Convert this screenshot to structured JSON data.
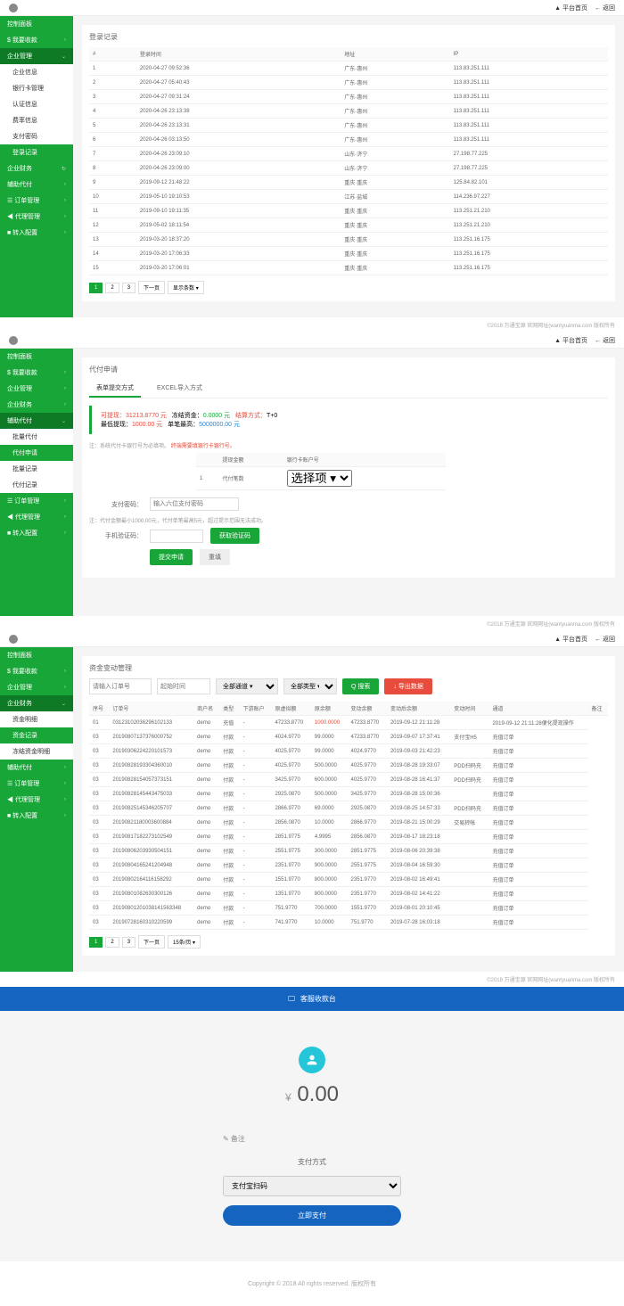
{
  "topbar": {
    "platform": "▲ 平台首页",
    "back": "← 返回"
  },
  "sidebar1": {
    "items": [
      "控制面板",
      "$ 我要收款",
      "企业管理"
    ],
    "sub1": [
      "企业信息",
      "银行卡管理",
      "认证信息",
      "费率信息",
      "支付密码",
      "登录记录"
    ],
    "items2": [
      "企业财务",
      "辅助代付",
      "☰ 订单管理",
      "◀ 代理管理",
      "■ 转入配置"
    ]
  },
  "panel1": {
    "title": "登录记录",
    "headers": [
      "#",
      "登录时间",
      "地址",
      "IP"
    ],
    "rows": [
      [
        "1",
        "2020-04-27 09:52:36",
        "广东·惠州",
        "113.83.251.111"
      ],
      [
        "2",
        "2020-04-27 05:40:43",
        "广东·惠州",
        "113.83.251.111"
      ],
      [
        "3",
        "2020-04-27 09:31:24",
        "广东·惠州",
        "113.83.251.111"
      ],
      [
        "4",
        "2020-04-26 23:13:38",
        "广东·惠州",
        "113.83.251.111"
      ],
      [
        "5",
        "2020-04-26 23:13:31",
        "广东·惠州",
        "113.83.251.111"
      ],
      [
        "6",
        "2020-04-26 03:13:50",
        "广东·惠州",
        "113.83.251.111"
      ],
      [
        "7",
        "2020-04-26 23:09:10",
        "山东·济宁",
        "27.198.77.225"
      ],
      [
        "8",
        "2020-04-26 23:09:00",
        "山东·济宁",
        "27.198.77.225"
      ],
      [
        "9",
        "2019-09-12 21:48:22",
        "重庆·重庆",
        "125.84.82.101"
      ],
      [
        "10",
        "2019-05-10 19:10:53",
        "江苏·盐城",
        "114.236.97.227"
      ],
      [
        "11",
        "2019-09-10 19:11:35",
        "重庆·重庆",
        "113.251.21.210"
      ],
      [
        "12",
        "2019-05-02 18:11:54",
        "重庆·重庆",
        "113.251.21.210"
      ],
      [
        "13",
        "2019-03-20 18:37:20",
        "重庆·重庆",
        "113.251.16.175"
      ],
      [
        "14",
        "2019-03-20 17:06:33",
        "重庆·重庆",
        "113.251.16.175"
      ],
      [
        "15",
        "2019-03-20 17:06:01",
        "重庆·重庆",
        "113.251.16.175"
      ]
    ],
    "pages": [
      "1",
      "2",
      "3",
      "下一页"
    ],
    "pageSize": "显示条数 ▾"
  },
  "footer": "©2018 万通宝源 官网网址(wantyuanma.com 版权所有",
  "sidebar2": {
    "items": [
      "控制面板",
      "$ 我要收款",
      "企业管理",
      "企业财务",
      "辅助代付"
    ],
    "sub": [
      "批量代付",
      "代付申请",
      "批量记录",
      "代付记录"
    ],
    "items2": [
      "☰ 订单管理",
      "◀ 代理管理",
      "■ 转入配置"
    ]
  },
  "panel2": {
    "title": "代付申请",
    "tabs": [
      "表单提交方式",
      "EXCEL导入方式"
    ],
    "info": {
      "l1a": "可提现：",
      "l1b": "31213.8770 元",
      "l1c": "冻结资金：",
      "l1d": "0.0000 元",
      "l1e": "结算方式：",
      "l1f": "T+0",
      "l2a": "最低提现：",
      "l2b": "1000.00 元",
      "l2c": "单笔最高：",
      "l2d": "5000000.00 元"
    },
    "note1": "注：系统代付卡银行号为必填项。",
    "note1b": "终端需要填银行卡银行号。",
    "th": [
      "",
      "提现金额",
      "银行卡账户号"
    ],
    "row1": [
      "1",
      "代付笔数",
      "选择项 ▾"
    ],
    "payPwdLabel": "支付密码：",
    "payPwdPh": "输入六位支付密码",
    "note2": "注：代付金额最小1000.00元，代付单笔最高5元，超过提示范围无法成功。",
    "codeLabel": "手机验证码：",
    "codeBtn": "获取验证码",
    "submit": "提交申请",
    "cancel": "重填"
  },
  "sidebar3": {
    "items": [
      "控制面板",
      "$ 我要收款",
      "企业管理",
      "企业财务"
    ],
    "sub": [
      "资金明细",
      "资金记录",
      "冻结资金明细"
    ],
    "items2": [
      "辅助代付",
      "☰ 订单管理",
      "◀ 代理管理",
      "■ 转入配置"
    ]
  },
  "panel3": {
    "title": "资金变动管理",
    "filters": {
      "orderPh": "请输入订单号",
      "startPh": "起始时间",
      "ch1": "全部通道 ▾",
      "ch2": "全部类型 ▾",
      "search": "Q 搜索",
      "export": "↓ 导出数据"
    },
    "headers": [
      "序号",
      "订单号",
      "商户名",
      "类型",
      "下游账户",
      "原虚拟额",
      "原余额",
      "变动余额",
      "变动后余额",
      "变动时间",
      "通道",
      "备注"
    ],
    "rows": [
      [
        "01",
        "03123102036296102133",
        "demo",
        "充值",
        "-",
        "47233.8770",
        "1000.0000",
        "47233.8770",
        "2019-09-12 21:11:28",
        "",
        "2019-09-12 21:11:28便化提现操作"
      ],
      [
        "03",
        "20190807137376000752",
        "demo",
        "付款",
        "-",
        "4024.9770",
        "99.0000",
        "47233.8770",
        "2019-09-07 17:37:41",
        "支付宝H5",
        "充值订单"
      ],
      [
        "03",
        "20190306224220101573",
        "demo",
        "付款",
        "-",
        "4025.9770",
        "99.0000",
        "4024.9770",
        "2019-09-03 21:42:23",
        "",
        "充值订单"
      ],
      [
        "03",
        "20190828193304360010",
        "demo",
        "付款",
        "-",
        "4025.9770",
        "500.0000",
        "4025.9770",
        "2019-08-28 19:33:07",
        "PDD扫码充",
        "充值订单"
      ],
      [
        "03",
        "20190828154057373151",
        "demo",
        "付款",
        "-",
        "3425.9770",
        "600.0000",
        "4025.9770",
        "2019-08-28 16:41:37",
        "PDD扫码充",
        "充值订单"
      ],
      [
        "03",
        "20190828145443475033",
        "demo",
        "付款",
        "-",
        "2925.0870",
        "500.0000",
        "3425.9770",
        "2019-08-28 15:00:36",
        "",
        "充值订单"
      ],
      [
        "03",
        "20190825145346205707",
        "demo",
        "付款",
        "-",
        "2866.9770",
        "69.0000",
        "2925.0870",
        "2019-08-25 14:57:33",
        "PDD扫码充",
        "充值订单"
      ],
      [
        "03",
        "20190821180003600884",
        "demo",
        "付款",
        "-",
        "2856.0870",
        "10.0000",
        "2866.9770",
        "2019-08-21 15:00:29",
        "交易转帐",
        "充值订单"
      ],
      [
        "03",
        "20190817182273102549",
        "demo",
        "付款",
        "-",
        "2851.9775",
        "4.9995",
        "2856.0870",
        "2019-08-17 18:23:18",
        "",
        "充值订单"
      ],
      [
        "03",
        "20190806203930504151",
        "demo",
        "付款",
        "-",
        "2551.9775",
        "300.0000",
        "2851.9775",
        "2019-08-06 20:39:38",
        "",
        "充值订单"
      ],
      [
        "03",
        "20190804165241204948",
        "demo",
        "付款",
        "-",
        "2351.9770",
        "900.0000",
        "2551.9775",
        "2019-08-04 16:59:30",
        "",
        "充值订单"
      ],
      [
        "03",
        "20190802164116158292",
        "demo",
        "付款",
        "-",
        "1551.9770",
        "800.0000",
        "2351.9770",
        "2019-08-02 16:49:41",
        "",
        "充值订单"
      ],
      [
        "03",
        "20190801082630300126",
        "demo",
        "付款",
        "-",
        "1351.9770",
        "800.0000",
        "2351.9770",
        "2019-08-02 14:41:22",
        "",
        "充值订单"
      ],
      [
        "03",
        "20190801201038141563348",
        "demo",
        "付款",
        "-",
        "751.9770",
        "700.0000",
        "1551.9770",
        "2019-08-01 20:10:45",
        "",
        "充值订单"
      ],
      [
        "03",
        "20190728160310220599",
        "demo",
        "付款",
        "-",
        "741.9770",
        "10.0000",
        "751.9770",
        "2019-07-28 16:03:18",
        "",
        "充值订单"
      ]
    ],
    "pages": [
      "1",
      "2",
      "3",
      "下一页"
    ],
    "pageSize": "15条/页 ▾"
  },
  "panel4": {
    "header": "客服收款台",
    "amount": "0.00",
    "currency": "¥",
    "remark": "✎ 备注",
    "payMethodTitle": "支付方式",
    "payMethodOpt": "支付宝扫码",
    "payBtn": "立即支付",
    "copyright": "Copyright © 2018 All rights reserved. 版权所有"
  }
}
